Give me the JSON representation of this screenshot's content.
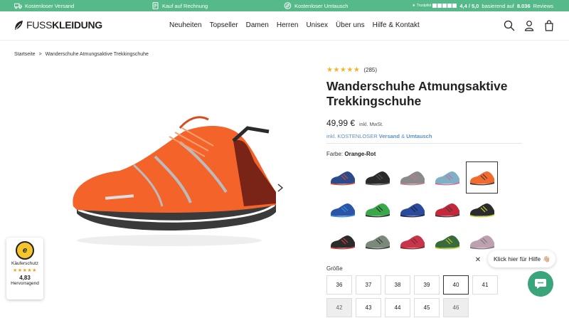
{
  "topbar": {
    "shipping": "Kostenloser Versand",
    "invoice": "Kauf auf Rechnung",
    "exchange": "Kostenloser Umtausch",
    "trustpilot_label": "Trustpilot",
    "rating_value": "4,4 / 5,0",
    "rating_text": "basierend auf",
    "review_count": "8.036",
    "reviews_word": "Reviews"
  },
  "header": {
    "logo_thin": "FUSS",
    "logo_bold": "KLEIDUNG",
    "nav": [
      "Neuheiten",
      "Topseller",
      "Damen",
      "Herren",
      "Unisex",
      "Über uns",
      "Hilfe & Kontakt"
    ]
  },
  "breadcrumb": {
    "home": "Startseite",
    "separator": ">",
    "current": "Wanderschuhe Atmungsaktive Trekkingschuhe"
  },
  "product": {
    "review_count": "(285)",
    "stars": "★★★★★",
    "title": "Wanderschuhe Atmungsaktive Trekkingschuhe",
    "price": "49,99 €",
    "vat": "inkl. MwSt.",
    "shipping_prefix": "inkl. KOSTENLOSER",
    "shipping_versand": "Versand",
    "shipping_and": "&",
    "shipping_umtausch": "Umtausch",
    "color_label": "Farbe:",
    "color_value": "Orange-Rot",
    "size_label": "Größe",
    "swatches": [
      {
        "colors": [
          "#2a4a8c",
          "#d24a3a"
        ]
      },
      {
        "colors": [
          "#2b2b2b",
          "#555555"
        ]
      },
      {
        "colors": [
          "#8a8a8a",
          "#c97a8a"
        ]
      },
      {
        "colors": [
          "#7fb0c4",
          "#d26aa0"
        ]
      },
      {
        "colors": [
          "#f26a2e",
          "#3a3a3a"
        ],
        "selected": true
      },
      {
        "colors": [
          "#2a55a8",
          "#3b8fd6"
        ]
      },
      {
        "colors": [
          "#3aa84a",
          "#2b2b2b"
        ]
      },
      {
        "colors": [
          "#2a4a9c",
          "#222244"
        ]
      },
      {
        "colors": [
          "#c4283a",
          "#3a3a3a"
        ]
      },
      {
        "colors": [
          "#2b2b2b",
          "#c8d43a"
        ]
      },
      {
        "colors": [
          "#2b2b2b",
          "#d23a3a"
        ]
      },
      {
        "colors": [
          "#7a8a7a",
          "#3a3a3a"
        ]
      },
      {
        "colors": [
          "#c8344a",
          "#7a2a2a"
        ]
      },
      {
        "colors": [
          "#3a6a3a",
          "#b8c83a"
        ]
      },
      {
        "colors": [
          "#bfa0b0",
          "#7a7a7a"
        ]
      }
    ],
    "sizes": [
      {
        "label": "36"
      },
      {
        "label": "37"
      },
      {
        "label": "38"
      },
      {
        "label": "39"
      },
      {
        "label": "40",
        "selected": true
      },
      {
        "label": "41"
      },
      {
        "label": "42",
        "unavailable": true
      },
      {
        "label": "43"
      },
      {
        "label": "44"
      },
      {
        "label": "45"
      },
      {
        "label": "46",
        "unavailable": true
      }
    ]
  },
  "trust_badge": {
    "seal": "e",
    "title": "Käuferschutz",
    "stars": "★★★★★",
    "score": "4,83",
    "rating_word": "Hervorragend"
  },
  "help": {
    "close": "✕",
    "text": "Klick hier für Hilfe",
    "emoji": "👋🏼"
  },
  "colors": {
    "topbar": "#55b98a",
    "link": "#5a8fc7",
    "chat": "#3aa57a",
    "star": "#f0b429"
  }
}
